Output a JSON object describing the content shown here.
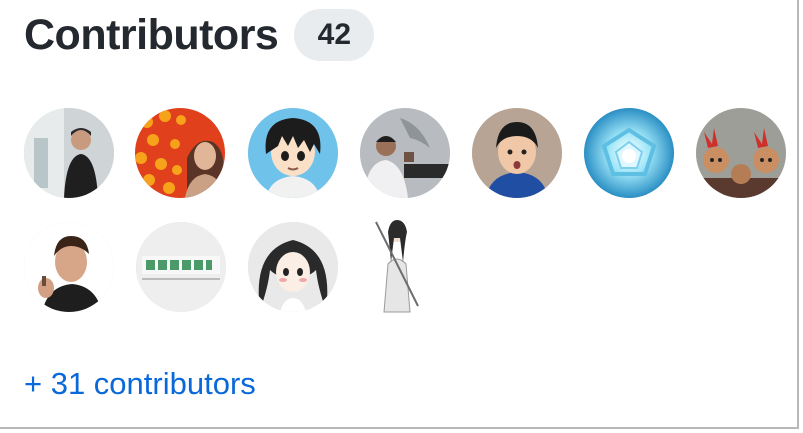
{
  "contributors": {
    "title": "Contributors",
    "count": "42",
    "more_link": "+ 31 contributors",
    "avatars": [
      {
        "name": "contributor-1"
      },
      {
        "name": "contributor-2"
      },
      {
        "name": "contributor-3"
      },
      {
        "name": "contributor-4"
      },
      {
        "name": "contributor-5"
      },
      {
        "name": "contributor-6"
      },
      {
        "name": "contributor-7"
      },
      {
        "name": "contributor-8"
      },
      {
        "name": "contributor-9"
      },
      {
        "name": "contributor-10"
      },
      {
        "name": "contributor-11"
      }
    ],
    "colors": {
      "link": "#0969da",
      "badge_bg": "#e9ecef",
      "text": "#24292f"
    }
  }
}
